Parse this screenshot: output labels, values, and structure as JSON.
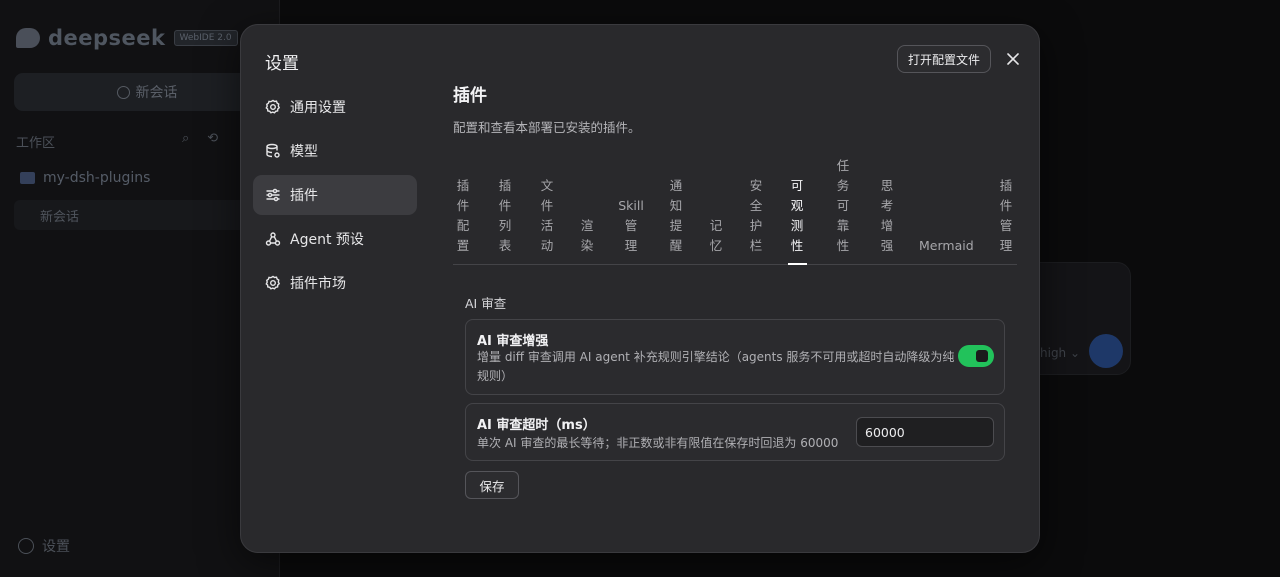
{
  "background": {
    "brand_text": "deepseek",
    "brand_badge": "WebIDE 2.0",
    "new_chat_label": "新会话",
    "workspace_label": "工作区",
    "folder_name": "my-dsh-plugins",
    "chat_item": "新会话",
    "bottom_settings": "设置",
    "model_hint": "high ⌄"
  },
  "modal": {
    "title": "设置",
    "open_config_label": "打开配置文件",
    "nav": [
      {
        "label": "通用设置",
        "icon": "gear-icon"
      },
      {
        "label": "模型",
        "icon": "database-icon"
      },
      {
        "label": "插件",
        "icon": "sliders-icon"
      },
      {
        "label": "Agent 预设",
        "icon": "agent-icon"
      },
      {
        "label": "插件市场",
        "icon": "gear-icon"
      }
    ],
    "active_nav": 2,
    "content": {
      "title": "插件",
      "subtitle": "配置和查看本部署已安装的插件。",
      "tabs": [
        {
          "label": "插件配置"
        },
        {
          "label": "插件列表"
        },
        {
          "label": "文件活动"
        },
        {
          "label": "渲染"
        },
        {
          "label": "Skill管理"
        },
        {
          "label": "通知提醒"
        },
        {
          "label": "记忆"
        },
        {
          "label": "安全护栏"
        },
        {
          "label": "可观测性"
        },
        {
          "label": "任务可靠性"
        },
        {
          "label": "思考增强"
        },
        {
          "label": "Mermaid"
        },
        {
          "label": "插件管理"
        }
      ],
      "active_tab": 8,
      "section_label": "AI 审查",
      "settings": [
        {
          "title": "AI 审查增强",
          "description_line1": "增量 diff 审查调用 AI agent 补充规则引擎结论（agents 服务不可用或超时自动降级为纯",
          "description_line2": "规则）",
          "enabled": true
        },
        {
          "title": "AI 审查超时（ms）",
          "description": "单次 AI 审查的最长等待；非正数或非有限值在保存时回退为 60000",
          "value": "60000"
        }
      ],
      "save_label": "保存"
    }
  },
  "colors": {
    "modal_bg": "#29292c",
    "toggle_on": "#22c25b",
    "active_nav_bg": "#3c3c40"
  }
}
